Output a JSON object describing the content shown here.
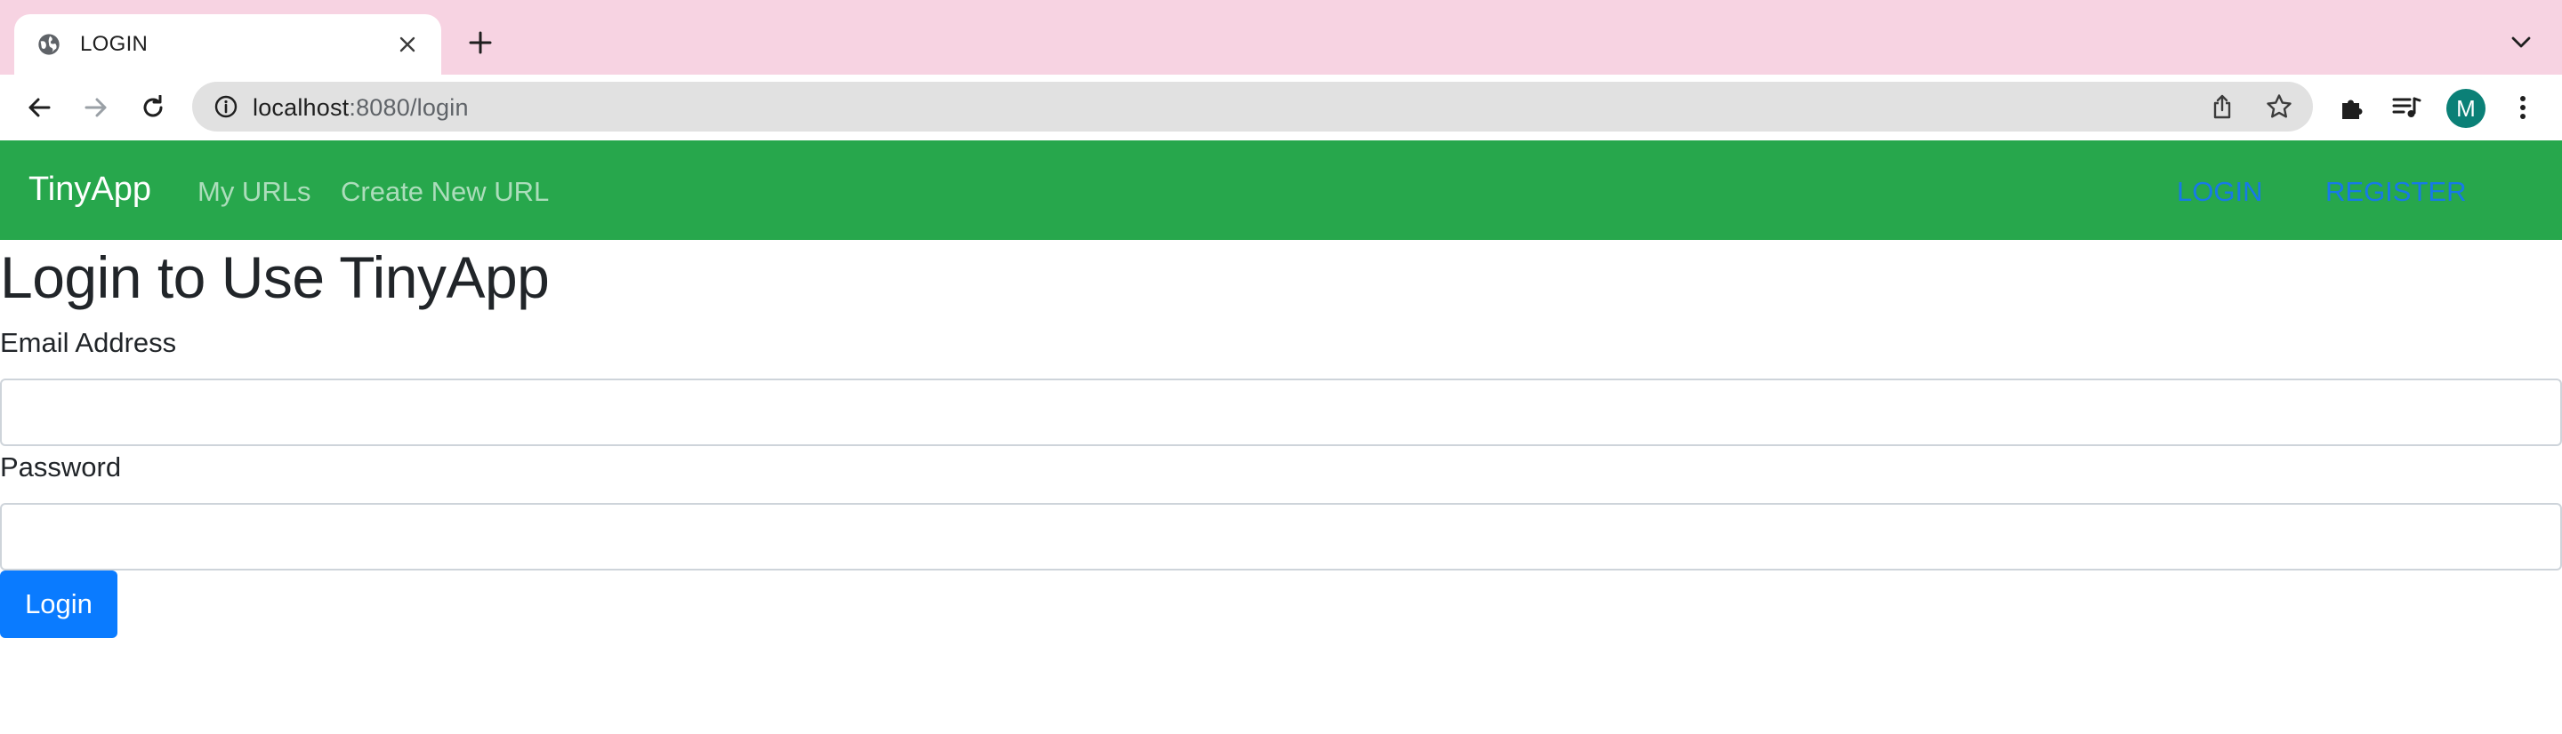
{
  "browser": {
    "tab_title": "LOGIN",
    "url_host": "localhost",
    "url_path": ":8080/login",
    "profile_initial": "M"
  },
  "navbar": {
    "brand": "TinyApp",
    "links": {
      "my_urls": "My URLs",
      "create_new_url": "Create New URL",
      "login": "LOGIN",
      "register": "REGISTER"
    },
    "bg_color": "#27a74c",
    "auth_link_color": "#1779e8"
  },
  "page": {
    "title": "Login to Use TinyApp",
    "email_label": "Email Address",
    "email_value": "",
    "password_label": "Password",
    "password_value": "",
    "submit_label": "Login",
    "submit_color": "#0a7bff"
  }
}
